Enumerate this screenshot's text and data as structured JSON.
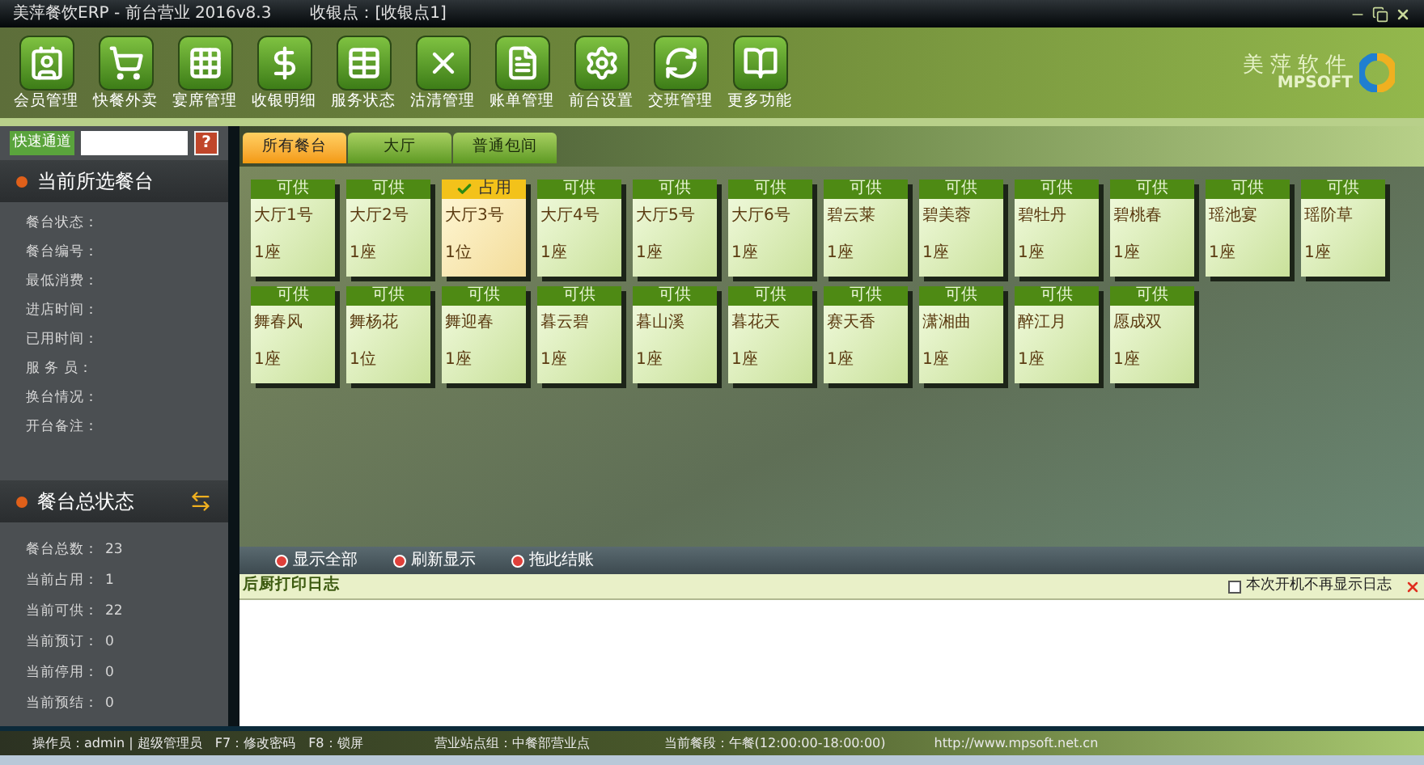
{
  "window": {
    "title": "美萍餐饮ERP - 前台营业 2016v8.3",
    "cashier_point": "收银点：[收银点1]"
  },
  "toolbar": [
    {
      "label": "会员管理",
      "kind": "member"
    },
    {
      "label": "快餐外卖",
      "kind": "cart"
    },
    {
      "label": "宴席管理",
      "kind": "grid"
    },
    {
      "label": "收银明细",
      "kind": "dollar"
    },
    {
      "label": "服务状态",
      "kind": "table"
    },
    {
      "label": "沽清管理",
      "kind": "cross"
    },
    {
      "label": "账单管理",
      "kind": "bill"
    },
    {
      "label": "前台设置",
      "kind": "gear"
    },
    {
      "label": "交班管理",
      "kind": "refresh"
    },
    {
      "label": "更多功能",
      "kind": "book"
    }
  ],
  "logo": {
    "name": "美萍软件",
    "brand": "MPSOFT"
  },
  "quick_channel": {
    "label": "快速通道",
    "help": "?"
  },
  "current_table": {
    "title": "当前所选餐台",
    "fields": [
      "餐台状态：",
      "餐台编号：",
      "最低消费：",
      "进店时间：",
      "已用时间：",
      "服 务 员：",
      "换台情况：",
      "开台备注："
    ]
  },
  "summary": {
    "title": "餐台总状态",
    "rows": [
      {
        "label": "餐台总数：",
        "value": "23"
      },
      {
        "label": "当前占用：",
        "value": "1"
      },
      {
        "label": "当前可供：",
        "value": "22"
      },
      {
        "label": "当前预订：",
        "value": "0"
      },
      {
        "label": "当前停用：",
        "value": "0"
      },
      {
        "label": "当前预结：",
        "value": "0"
      }
    ]
  },
  "tabs": [
    {
      "label": "所有餐台",
      "selected": true
    },
    {
      "label": "大厅",
      "selected": false
    },
    {
      "label": "普通包间",
      "selected": false
    }
  ],
  "tables": [
    [
      {
        "status": "可供",
        "occupied": false,
        "name": "大厅1号",
        "seats": "1座"
      },
      {
        "status": "可供",
        "occupied": false,
        "name": "大厅2号",
        "seats": "1座"
      },
      {
        "status": "占用",
        "occupied": true,
        "name": "大厅3号",
        "seats": "1位"
      },
      {
        "status": "可供",
        "occupied": false,
        "name": "大厅4号",
        "seats": "1座"
      },
      {
        "status": "可供",
        "occupied": false,
        "name": "大厅5号",
        "seats": "1座"
      },
      {
        "status": "可供",
        "occupied": false,
        "name": "大厅6号",
        "seats": "1座"
      },
      {
        "status": "可供",
        "occupied": false,
        "name": "碧云莱",
        "seats": "1座"
      },
      {
        "status": "可供",
        "occupied": false,
        "name": "碧美蓉",
        "seats": "1座"
      },
      {
        "status": "可供",
        "occupied": false,
        "name": "碧牡丹",
        "seats": "1座"
      },
      {
        "status": "可供",
        "occupied": false,
        "name": "碧桃春",
        "seats": "1座"
      },
      {
        "status": "可供",
        "occupied": false,
        "name": "瑶池宴",
        "seats": "1座"
      },
      {
        "status": "可供",
        "occupied": false,
        "name": "瑶阶草",
        "seats": "1座"
      }
    ],
    [
      {
        "status": "可供",
        "occupied": false,
        "name": "舞春风",
        "seats": "1座"
      },
      {
        "status": "可供",
        "occupied": false,
        "name": "舞杨花",
        "seats": "1位"
      },
      {
        "status": "可供",
        "occupied": false,
        "name": "舞迎春",
        "seats": "1座"
      },
      {
        "status": "可供",
        "occupied": false,
        "name": "暮云碧",
        "seats": "1座"
      },
      {
        "status": "可供",
        "occupied": false,
        "name": "暮山溪",
        "seats": "1座"
      },
      {
        "status": "可供",
        "occupied": false,
        "name": "暮花天",
        "seats": "1座"
      },
      {
        "status": "可供",
        "occupied": false,
        "name": "赛天香",
        "seats": "1座"
      },
      {
        "status": "可供",
        "occupied": false,
        "name": "潇湘曲",
        "seats": "1座"
      },
      {
        "status": "可供",
        "occupied": false,
        "name": "醉江月",
        "seats": "1座"
      },
      {
        "status": "可供",
        "occupied": false,
        "name": "愿成双",
        "seats": "1座"
      }
    ]
  ],
  "actions": [
    "显示全部",
    "刷新显示",
    "拖此结账"
  ],
  "log": {
    "title": "后厨打印日志",
    "hide_option": {
      "label": "本次开机不再显示日志",
      "checked": false
    }
  },
  "status_bar": [
    "操作员：admin | 超级管理员",
    "F7：修改密码",
    "F8：锁屏",
    "营业站点组：中餐部营业点",
    "当前餐段：午餐(12:00:00-18:00:00)",
    "http://www.mpsoft.net.cn"
  ]
}
